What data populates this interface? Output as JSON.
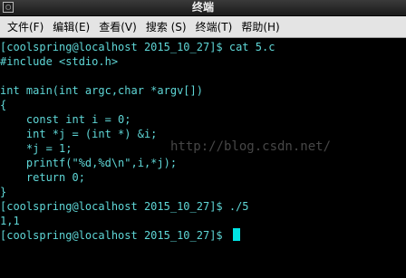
{
  "window": {
    "title": "终端",
    "icon_glyph": "▢"
  },
  "menu": [
    {
      "label": "文件(F)"
    },
    {
      "label": "编辑(E)"
    },
    {
      "label": "查看(V)"
    },
    {
      "label": "搜索 (S)"
    },
    {
      "label": "终端(T)"
    },
    {
      "label": "帮助(H)"
    }
  ],
  "terminal": {
    "lines": [
      "[coolspring@localhost 2015_10_27]$ cat 5.c",
      "#include <stdio.h>",
      "",
      "int main(int argc,char *argv[])",
      "{",
      "    const int i = 0;",
      "    int *j = (int *) &i;",
      "    *j = 1;",
      "    printf(\"%d,%d\\n\",i,*j);",
      "    return 0;",
      "}",
      "[coolspring@localhost 2015_10_27]$ ./5",
      "1,1",
      "[coolspring@localhost 2015_10_27]$ "
    ],
    "watermark": "http://blog.csdn.net/"
  },
  "colors": {
    "text": "#5fd7d7",
    "cursor": "#00e5e5",
    "background": "#000000"
  }
}
